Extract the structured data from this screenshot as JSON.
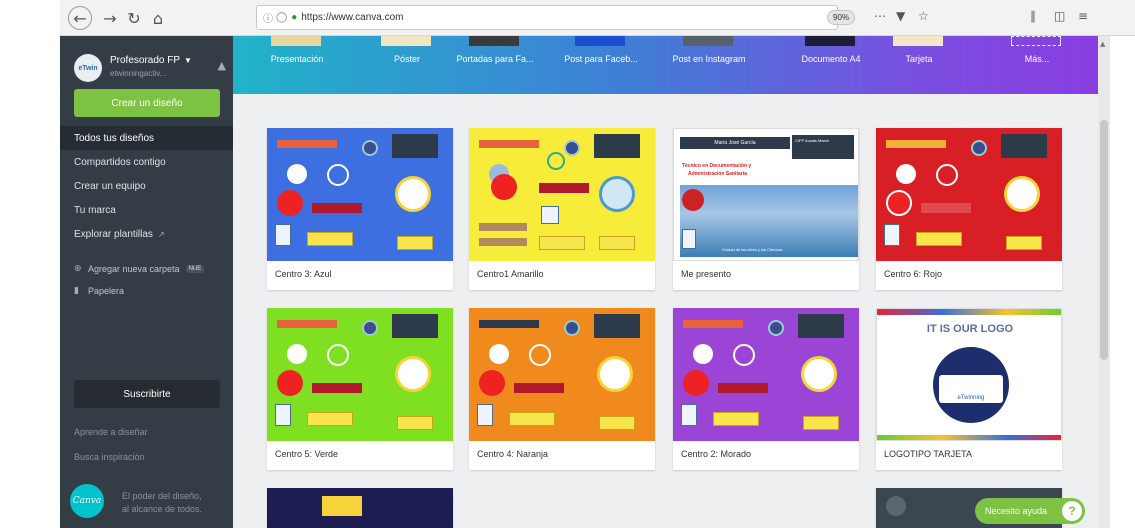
{
  "browser": {
    "url": "https://www.canva.com",
    "zoom": "90%"
  },
  "sidebar": {
    "profile_name": "Profesorado FP",
    "profile_user": "etwinningactiv...",
    "avatar_text": "eTwin",
    "create_label": "Crear un diseño",
    "nav": [
      {
        "label": "Todos tus diseños"
      },
      {
        "label": "Compartidos contigo"
      },
      {
        "label": "Crear un equipo"
      },
      {
        "label": "Tu marca"
      },
      {
        "label": "Explorar plantillas"
      }
    ],
    "add_folder_label": "Agregar nueva carpeta",
    "add_folder_badge": "NUE",
    "trash_label": "Papelera",
    "subscribe_label": "Suscribirte",
    "learn_label": "Aprende a diseñar",
    "help_label": "Busca inspiración",
    "logo_text": "Canva",
    "slogan_line1": "El poder del diseño,",
    "slogan_line2": "al alcance de todos."
  },
  "doc_types": [
    {
      "label": "Presentación"
    },
    {
      "label": "Póster"
    },
    {
      "label": "Portadas para Fa..."
    },
    {
      "label": "Post para Faceb..."
    },
    {
      "label": "Post en Instagram"
    },
    {
      "label": "Documento A4"
    },
    {
      "label": "Tarjeta"
    },
    {
      "label": "Más..."
    }
  ],
  "designs": [
    {
      "title": "Centro 3: Azul",
      "bg": "#3d6fe0"
    },
    {
      "title": "Centro1 Amarillo",
      "bg": "#f7ec3a"
    },
    {
      "title": "Me presento",
      "bg": "#ffffff"
    },
    {
      "title": "Centro 6: Rojo",
      "bg": "#d91f26"
    },
    {
      "title": "Centro 5: Verde",
      "bg": "#7ee020"
    },
    {
      "title": "Centro 4: Naranja",
      "bg": "#f08a1c"
    },
    {
      "title": "Centro 2: Morado",
      "bg": "#9a45d6"
    },
    {
      "title": "LOGOTIPO TARJETA",
      "bg": "#ffffff"
    }
  ],
  "logo_card": {
    "heading": "IT IS OUR LOGO",
    "brand": "eTwinning"
  },
  "me_presento": {
    "name": "María José García",
    "line1": "Técnico en Documentación y",
    "line2": "Administración Sanitaria",
    "place": "Ciudad de las Artes y las Ciencias",
    "box": "CIFP Ausiàs March"
  },
  "help_button": "Necesito ayuda",
  "help_q": "?"
}
